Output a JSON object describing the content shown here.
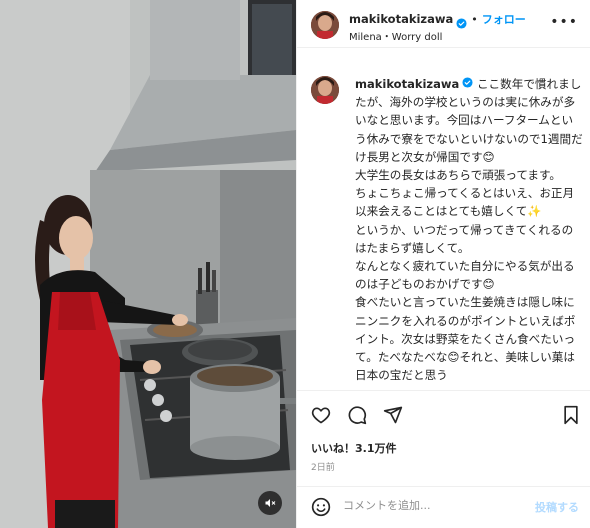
{
  "post": {
    "username": "makikotakizawa",
    "separator": "•",
    "follow_label": "フォロー",
    "audio": "Milena・Worry doll",
    "caption": "ここ数年で慣れましたが、海外の学校というのは実に休みが多いなと思います。今回はハーフタームという休みで寮をでないといけないので1週間だけ長男と次女が帰国です😊\n大学生の長女はあちらで頑張ってます。\nちょこちょこ帰ってくるとはいえ、お正月以来会えることはとても嬉しくて✨\nというか、いつだって帰ってきてくれるのはたまらず嬉しくて。\nなんとなく疲れていた自分にやる気が出るのは子どものおかげです😊\n食べたいと言っていた生姜焼きは隠し味にニンニクを入れるのがポイントといえばポイント。次女は野菜をたくさん食べたいって。たべなたべな😊それと、美味しい菓は日本の宝だと思う",
    "likes": "いいね！3.1万件",
    "date": "2日前"
  },
  "comment": {
    "placeholder": "コメントを追加...",
    "post_label": "投稿する"
  },
  "icons": {
    "more": "more-icon",
    "like": "heart-icon",
    "comment": "comment-icon",
    "share": "share-icon",
    "save": "bookmark-icon",
    "emoji": "emoji-icon",
    "audio": "speaker-muted-icon",
    "verified": "verified-badge-icon"
  },
  "colors": {
    "accent": "#0095f6",
    "text": "#262626",
    "muted": "#8e8e8e",
    "verified": "#0095f6"
  }
}
